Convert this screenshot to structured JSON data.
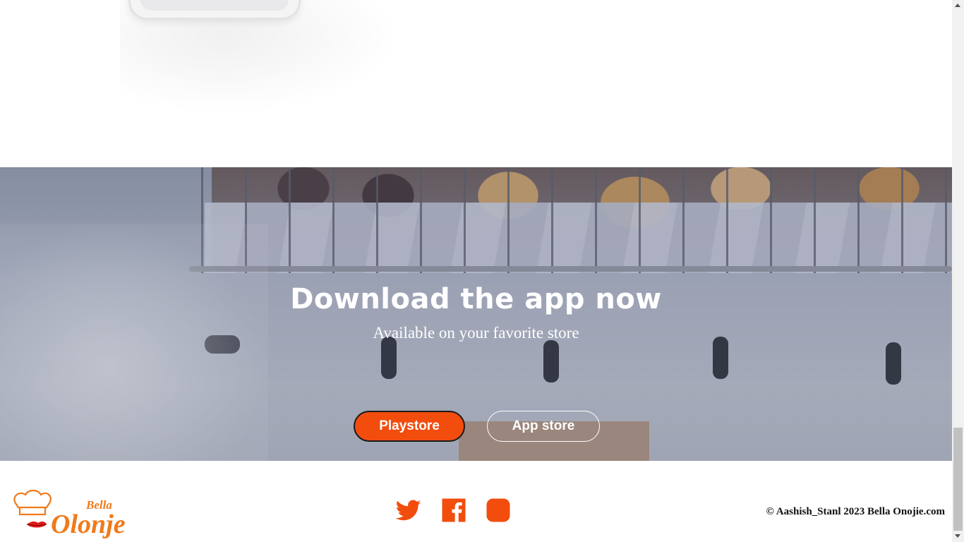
{
  "download": {
    "title": "Download the app now",
    "subtitle": "Available on your favorite store",
    "playstore_label": "Playstore",
    "appstore_label": "App store"
  },
  "footer": {
    "logo_text_top": "Bella",
    "logo_text_main": "Olonje",
    "social": [
      "twitter-icon",
      "facebook-icon",
      "instagram-icon"
    ],
    "copyright": "© Aashish_Stanl 2023 Bella Onojie.com"
  },
  "colors": {
    "accent": "#f24d0d",
    "white": "#ffffff"
  }
}
